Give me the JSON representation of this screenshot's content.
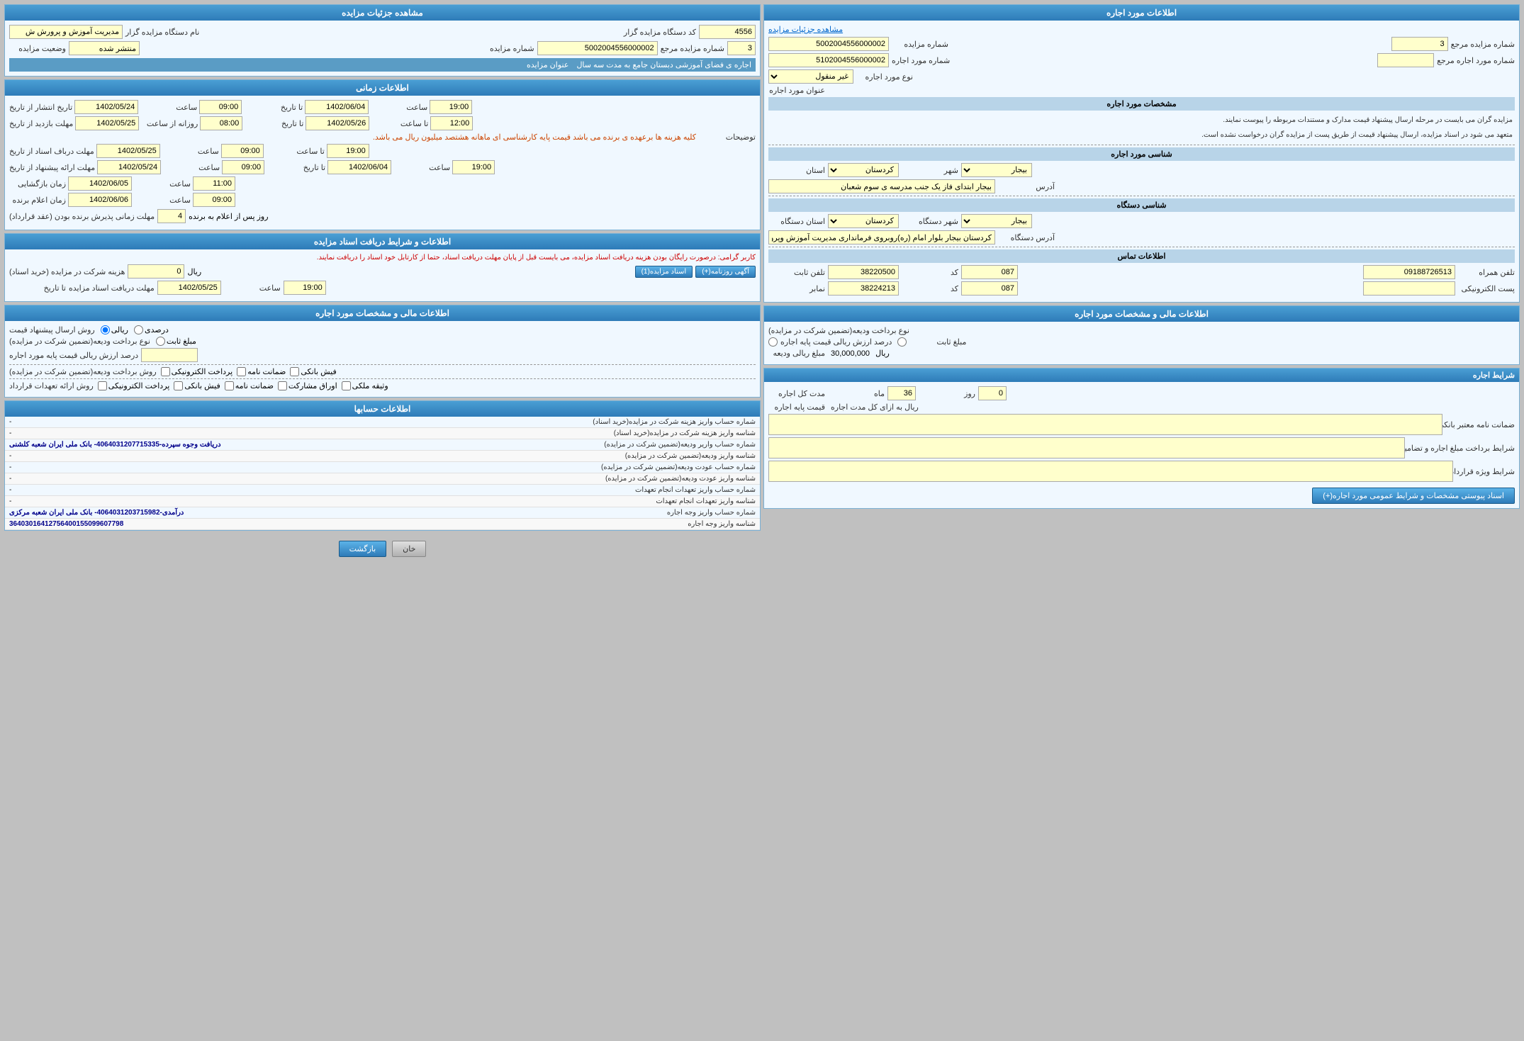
{
  "left_panel": {
    "title": "اطلاعات مورد اجاره",
    "link_label": "مشاهده جزئیات مزایده",
    "fields": {
      "auction_number_label": "شماره مزایده",
      "auction_number_value": "5002004556000002",
      "auction_ref_label": "شماره مزایده مرجع",
      "auction_ref_value": "3",
      "rent_number_label": "شماره مورد اجاره",
      "rent_number_value": "5102004556000002",
      "rent_ref_label": "شماره مورد اجاره مرجع",
      "rent_ref_value": "",
      "rent_type_label": "نوع مورد اجاره",
      "rent_type_value": "غیر منقول",
      "rent_address_label": "عنوان مورد اجاره",
      "rent_address_value": ""
    },
    "specs_title": "مشخصات مورد اجاره",
    "info_text1": "مزایده گران می بایست در مرحله ارسال پیشنهاد قیمت مدارک و مستندات مربوطه را پیوست نمایند.",
    "info_text2": "متعهد می شود در اسناد مزایده، ارسال پیشنهاد قیمت از طریق پست از مزایده گران درخواست نشده است.",
    "location_title": "شناسی مورد اجاره",
    "province_label": "استان",
    "province_value": "کردستان",
    "city_label": "شهر",
    "city_value": "بیجار",
    "address_label": "آدرس",
    "address_value": "بیجار ابتدای فاز یک جنب مدرسه ی سوم شعبان",
    "device_title": "شناسی دستگاه",
    "device_province_label": "استان دستگاه",
    "device_province_value": "کردستان",
    "device_city_label": "شهر دستگاه",
    "device_city_value": "بیجار",
    "device_address_label": "آدرس دستگاه",
    "device_address_value": "کردستان بیجار بلوار امام (ره)روبروی فرمانداری مدیریت آموزش وپرورش بیجار",
    "contact_title": "اطلاعات تماس",
    "fixed_phone_label": "تلفن ثابت",
    "fixed_phone_value": "38220500",
    "fixed_code_label": "کد",
    "fixed_code_value": "087",
    "mobile_label": "تلفن همراه",
    "mobile_value": "09188726513",
    "fax_label": "نمابر",
    "fax_value": "38224213",
    "fax_code_label": "کد",
    "fax_code_value": "087",
    "email_label": "پست الکترونیکی",
    "email_value": ""
  },
  "left_financial": {
    "title": "اطلاعات مالی و مشخصات مورد اجاره",
    "payment_method_label": "نوع برداخت ودیعه(تضمین شرکت در مزایده)",
    "percent_label": "درصد ارزش ریالی قیمت پایه اجاره",
    "percent_value": "",
    "fixed_amount_label": "مبلغ ثابت",
    "deposit_label": "مبلغ ریالی ودیعه",
    "deposit_value": "30,000,000",
    "currency": "ریال"
  },
  "left_conditions": {
    "title": "شرایط اجاره",
    "duration_label": "مدت کل اجاره",
    "months": "36",
    "month_label": "ماه",
    "days": "0",
    "day_label": "روز",
    "base_price_label": "قیمت پایه اجاره",
    "per_period_label": "ریال به ازای کل مدت اجاره",
    "guarantee_label": "ضمانت نامه معتبر بانکی",
    "conditions_text_label": "شرایط برداخت مبلغ اجاره و تضامین آن",
    "special_conditions_label": "شرایط ویژه قرارداد",
    "docs_button": "اسناد پیوستی مشخصات و شرایط عمومی مورد اجاره(+)"
  },
  "right_panel": {
    "title": "مشاهده جزئیات مزایده",
    "auction_code_label": "کد دستگاه مزایده گزار",
    "auction_code_value": "4556",
    "auction_number_label": "شماره مزایده",
    "auction_number_value": "5002004556000002",
    "auction_ref_label": "شماره مزایده مرجع",
    "auction_ref_value": "3",
    "device_name_label": "نام دستگاه مزایده گزار",
    "device_name_value": "مدیریت آموزش و پرورش ش",
    "status_label": "وضعیت مزایده",
    "status_value": "منتشر شده",
    "title_label": "عنوان مزایده",
    "title_value": "اجاره ی فضای آموزشی دبستان جامع به مدت سه سال"
  },
  "right_time": {
    "title": "اطلاعات زمانی",
    "start_date_label": "تاریخ انتشار از تاریخ",
    "start_date_value": "1402/05/24",
    "start_time_label": "ساعت",
    "start_time_value": "09:00",
    "end_date_label": "تا تاریخ",
    "end_date_value": "1402/06/04",
    "end_time_label": "ساعت",
    "end_time_value": "19:00",
    "deadline_date_label": "مهلت بازدید از تاریخ",
    "deadline_date_value": "1402/05/25",
    "deadline_time_label": "روزانه از ساعت",
    "deadline_time_value": "08:00",
    "deadline_end_date": "1402/05/26",
    "deadline_end_time": "12:00",
    "notes_label": "توضیحات",
    "notes_value": "کلیه هزینه ها برعهده ی برنده می باشد قیمت پایه کارشناسی ای ماهانه هشتصد میلیون ریال می باشد.",
    "submit_from_label": "مهلت درباف اسناد از تاریخ",
    "submit_from_date": "1402/05/25",
    "submit_from_time": "09:00",
    "submit_from_end": "19:00",
    "submit_price_label": "مهلت ارائه پیشنهاد از تاریخ",
    "submit_price_from": "1402/05/24",
    "submit_price_from_time": "09:00",
    "submit_price_to": "1402/06/04",
    "submit_price_to_time": "19:00",
    "opening_label": "زمان بازگشایی",
    "opening_date": "1402/06/05",
    "opening_time": "11:00",
    "announce_label": "زمان اعلام برنده",
    "announce_date": "1402/06/06",
    "announce_time": "09:00",
    "contract_days_label": "مهلت زمانی پذیرش برنده بودن (عقد قرارداد)",
    "contract_days_value": "4",
    "contract_days_unit": "روز پس از اعلام به برنده"
  },
  "right_financial": {
    "title": "اطلاعات و شرایط دریافت اسناد مزایده",
    "warning_text": "کاربر گرامی: درصورت رایگان بودن هزینه دریافت اسناد مزایده، می بایست قبل از پایان مهلت دریافت اسناد، حتما از کارتابل خود اسناد را دریافت نمایند.",
    "document_fee_label": "هزینه شرکت در مزایده (خرید اسناد)",
    "document_fee_value": "0",
    "currency": "ریال",
    "doc_type_label": "اسناد مزایده(1)",
    "doc_type_btn": "اسناد مزایده(1)",
    "schedule_btn": "آگهی روزنامه(+)",
    "deadline_receive_label": "مهلت دریافت اسناد مزایده",
    "deadline_receive_date": "1402/05/25",
    "deadline_receive_time": "19:00"
  },
  "right_rent_financial": {
    "title": "اطلاعات مالی و مشخصات مورد اجاره",
    "send_method_label": "روش ارسال پیشنهاد قیمت",
    "amount_method_label": "ریالی",
    "percent_label": "درصدی",
    "payment_type_label": "نوع برداخت ودیعه(تضمین شرکت در مزایده)",
    "fixed_amount_label": "مبلغ ثابت",
    "base_price_label": "درصد ارزش ریالی قیمت پایه مورد اجاره",
    "payment_methods_label": "روش برداخت ودیعه(تضمین شرکت در مزایده)",
    "electronic_label": "پرداخت الکترونیکی",
    "guarantee_label": "ضمانت نامه",
    "bank_check_label": "فیش بانکی",
    "contract_method_label": "روش ارائه تعهدات قرارداد",
    "electronic2_label": "پرداخت الکترونیکی",
    "bank_check2_label": "فیش بانکی",
    "guarantee2_label": "ضمانت نامه",
    "shares_label": "اوراق مشارکت",
    "deed_label": "وثیقه ملکی"
  },
  "right_accounts": {
    "title": "اطلاعات حسابها",
    "rows": [
      {
        "label": "شماره حساب واریز هزینه شرکت در مزایده(خرید اسناد)",
        "value": "-"
      },
      {
        "label": "شناسه واریز هزینه شرکت در مزایده(خرید اسناد)",
        "value": "-"
      },
      {
        "label": "شماره حساب واریر ودیعه(تضمین شرکت در مزایده)",
        "value": "دریافت وجوه سپرده-4064031207715335- بانک ملی ایران شعبه کلشنی"
      },
      {
        "label": "شناسه واریز ودیعه(تضمین شرکت در مزایده)",
        "value": "-"
      },
      {
        "label": "شماره حساب عودت ودیعه(تضمین شرکت در مزایده)",
        "value": "-"
      },
      {
        "label": "شناسه واریز عودت ودیعه(تضمین شرکت در مزایده)",
        "value": "-"
      },
      {
        "label": "شماره حساب واریز تعهدات انجام تعهدات",
        "value": "-"
      },
      {
        "label": "شناسه واریز تعهدات انجام تعهدات",
        "value": "-"
      },
      {
        "label": "شماره حساب واریز وجه اجاره",
        "value": "درآمدی-4064031203715982- بانک ملی ایران شعبه مرکزی"
      },
      {
        "label": "شناسه واریز وجه اجاره",
        "value": "36403016412756400155099607798"
      }
    ]
  },
  "footer": {
    "cancel_btn": "خان",
    "back_btn": "بازگشت"
  }
}
